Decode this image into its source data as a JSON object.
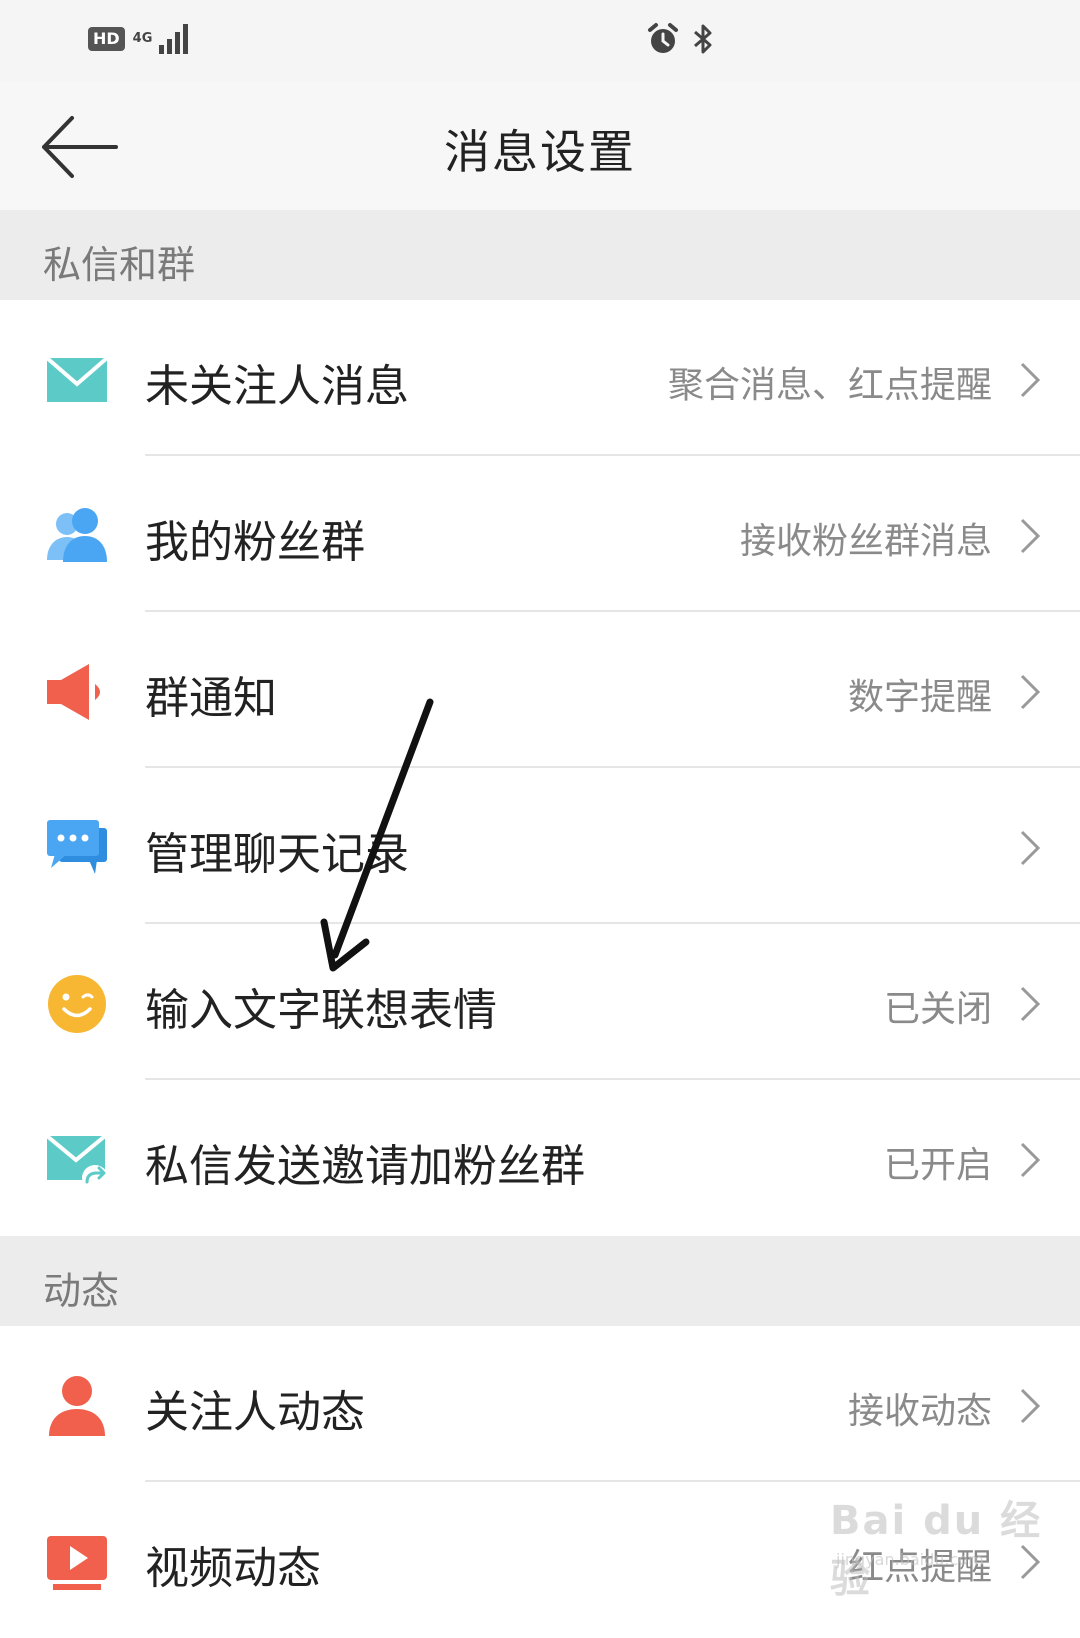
{
  "statusbar": {
    "hd": "HD",
    "network": "4G"
  },
  "header": {
    "title": "消息设置"
  },
  "sections": [
    {
      "title": "私信和群",
      "items": [
        {
          "label": "未关注人消息",
          "value": "聚合消息、红点提醒",
          "icon": "mail-icon",
          "color": "#5ccbc8"
        },
        {
          "label": "我的粉丝群",
          "value": "接收粉丝群消息",
          "icon": "people-icon",
          "color": "#4aa6f2"
        },
        {
          "label": "群通知",
          "value": "数字提醒",
          "icon": "megaphone-icon",
          "color": "#f0604d"
        },
        {
          "label": "管理聊天记录",
          "value": "",
          "icon": "chat-bubble-icon",
          "color": "#4aa6f2"
        },
        {
          "label": "输入文字联想表情",
          "value": "已关闭",
          "icon": "smiley-icon",
          "color": "#f7b733"
        },
        {
          "label": "私信发送邀请加粉丝群",
          "value": "已开启",
          "icon": "mail-forward-icon",
          "color": "#5ccbc8"
        }
      ]
    },
    {
      "title": "动态",
      "items": [
        {
          "label": "关注人动态",
          "value": "接收动态",
          "icon": "person-icon",
          "color": "#f0604d"
        },
        {
          "label": "视频动态",
          "value": "红点提醒",
          "icon": "video-icon",
          "color": "#f0604d"
        }
      ]
    }
  ],
  "watermark": "Bai du 经验",
  "watermark_url": "jingyan.baidu.com"
}
